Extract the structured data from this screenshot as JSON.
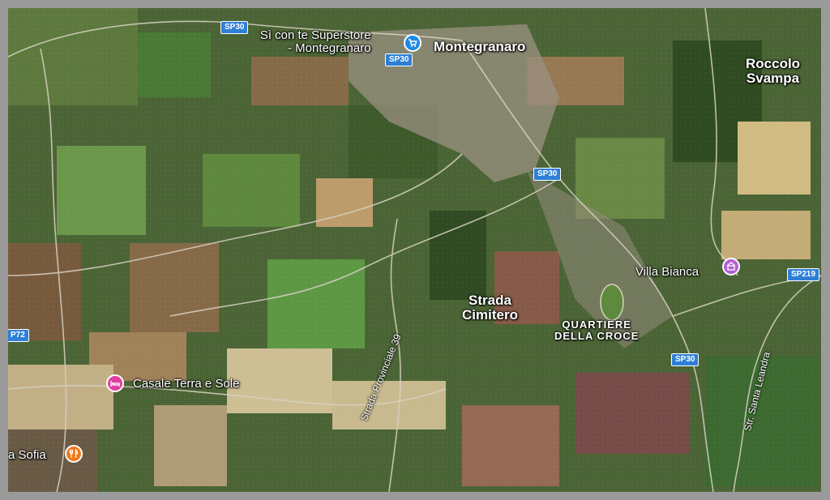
{
  "map": {
    "places": {
      "montegranaro": "Montegranaro",
      "roccolo_line1": "Roccolo",
      "roccolo_line2": "Svampa",
      "strada_cimitero_line1": "Strada",
      "strada_cimitero_line2": "Cimitero",
      "quartiere_line1": "QUARTIERE",
      "quartiere_line2": "DELLA CROCE"
    },
    "pois": {
      "superstore_line1": "Sì con te Superstore",
      "superstore_line2": "- Montegranaro",
      "villa_bianca": "Villa Bianca",
      "casale": "Casale Terra e Sole",
      "sofia": "a Sofia"
    },
    "road_shields": {
      "sp30_a": "SP30",
      "sp30_b": "SP30",
      "sp30_c": "SP30",
      "sp30_d": "SP30",
      "sp219": "SP219",
      "p72": "P72"
    },
    "road_names": {
      "provinciale": "Strada Provinciale 39",
      "santa_leandra": "Str. Santa Leandra"
    },
    "colors": {
      "shopping": "#1e88e5",
      "hotel": "#e040a0",
      "food": "#f07a1a",
      "landmark": "#b35fd6",
      "shield": "#2f7fd6"
    },
    "icons": {
      "shopping": "shopping-cart-icon",
      "hotel": "bed-icon",
      "food": "restaurant-icon",
      "landmark": "landmark-icon"
    }
  }
}
